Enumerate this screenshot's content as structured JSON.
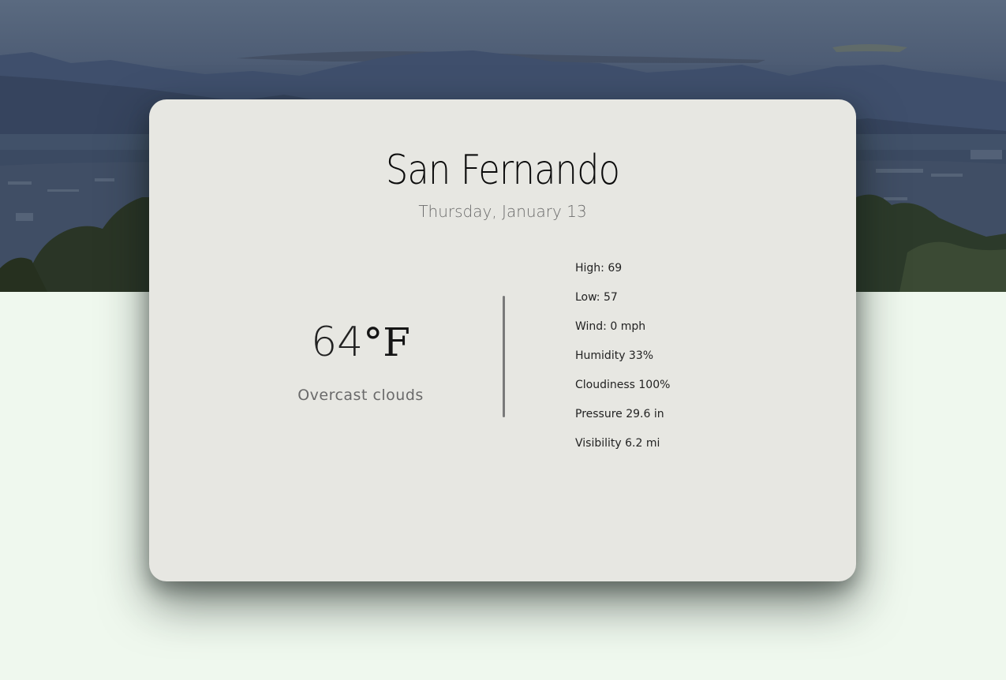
{
  "location": {
    "city": "San Fernando",
    "date": "Thursday, January 13"
  },
  "current": {
    "temperature": "64",
    "unit": "°F",
    "description": "Overcast clouds"
  },
  "details": [
    "High: 69",
    "Low: 57",
    "Wind: 0 mph",
    "Humidity 33%",
    "Cloudiness 100%",
    "Pressure 29.6 in",
    "Visibility 6.2 mi"
  ],
  "colors": {
    "page_background": "#eff8ee",
    "card_background": "#e7e7e2",
    "hero_sky": "#5a6a80",
    "text_primary": "#0c0c0c",
    "text_secondary": "#6c6c6c"
  }
}
